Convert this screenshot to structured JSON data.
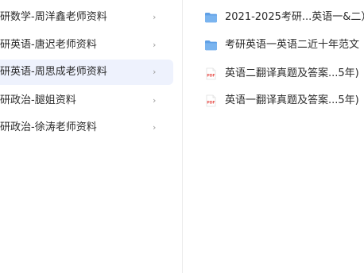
{
  "left_list": {
    "items": [
      {
        "label": "研数学-周洋鑫老师资料",
        "selected": false
      },
      {
        "label": "研英语-唐迟老师资料",
        "selected": false
      },
      {
        "label": "研英语-周思成老师资料",
        "selected": true
      },
      {
        "label": "研政治-腿姐资料",
        "selected": false
      },
      {
        "label": "研政治-徐涛老师资料",
        "selected": false
      }
    ],
    "chevron_glyph": "›"
  },
  "right_list": {
    "items": [
      {
        "name": "2021-2025考研...英语一&二）",
        "icon": "folder-icon"
      },
      {
        "name": "考研英语一英语二近十年范文",
        "icon": "folder-icon"
      },
      {
        "name": "英语二翻译真题及答案...5年)",
        "icon": "pdf-icon"
      },
      {
        "name": "英语一翻译真题及答案...5年)",
        "icon": "pdf-icon"
      }
    ],
    "pdf_badge": "PDF"
  },
  "colors": {
    "selected_bg": "#eef2fd",
    "folder": "#5fa0e6",
    "pdf": "#e8504b"
  }
}
